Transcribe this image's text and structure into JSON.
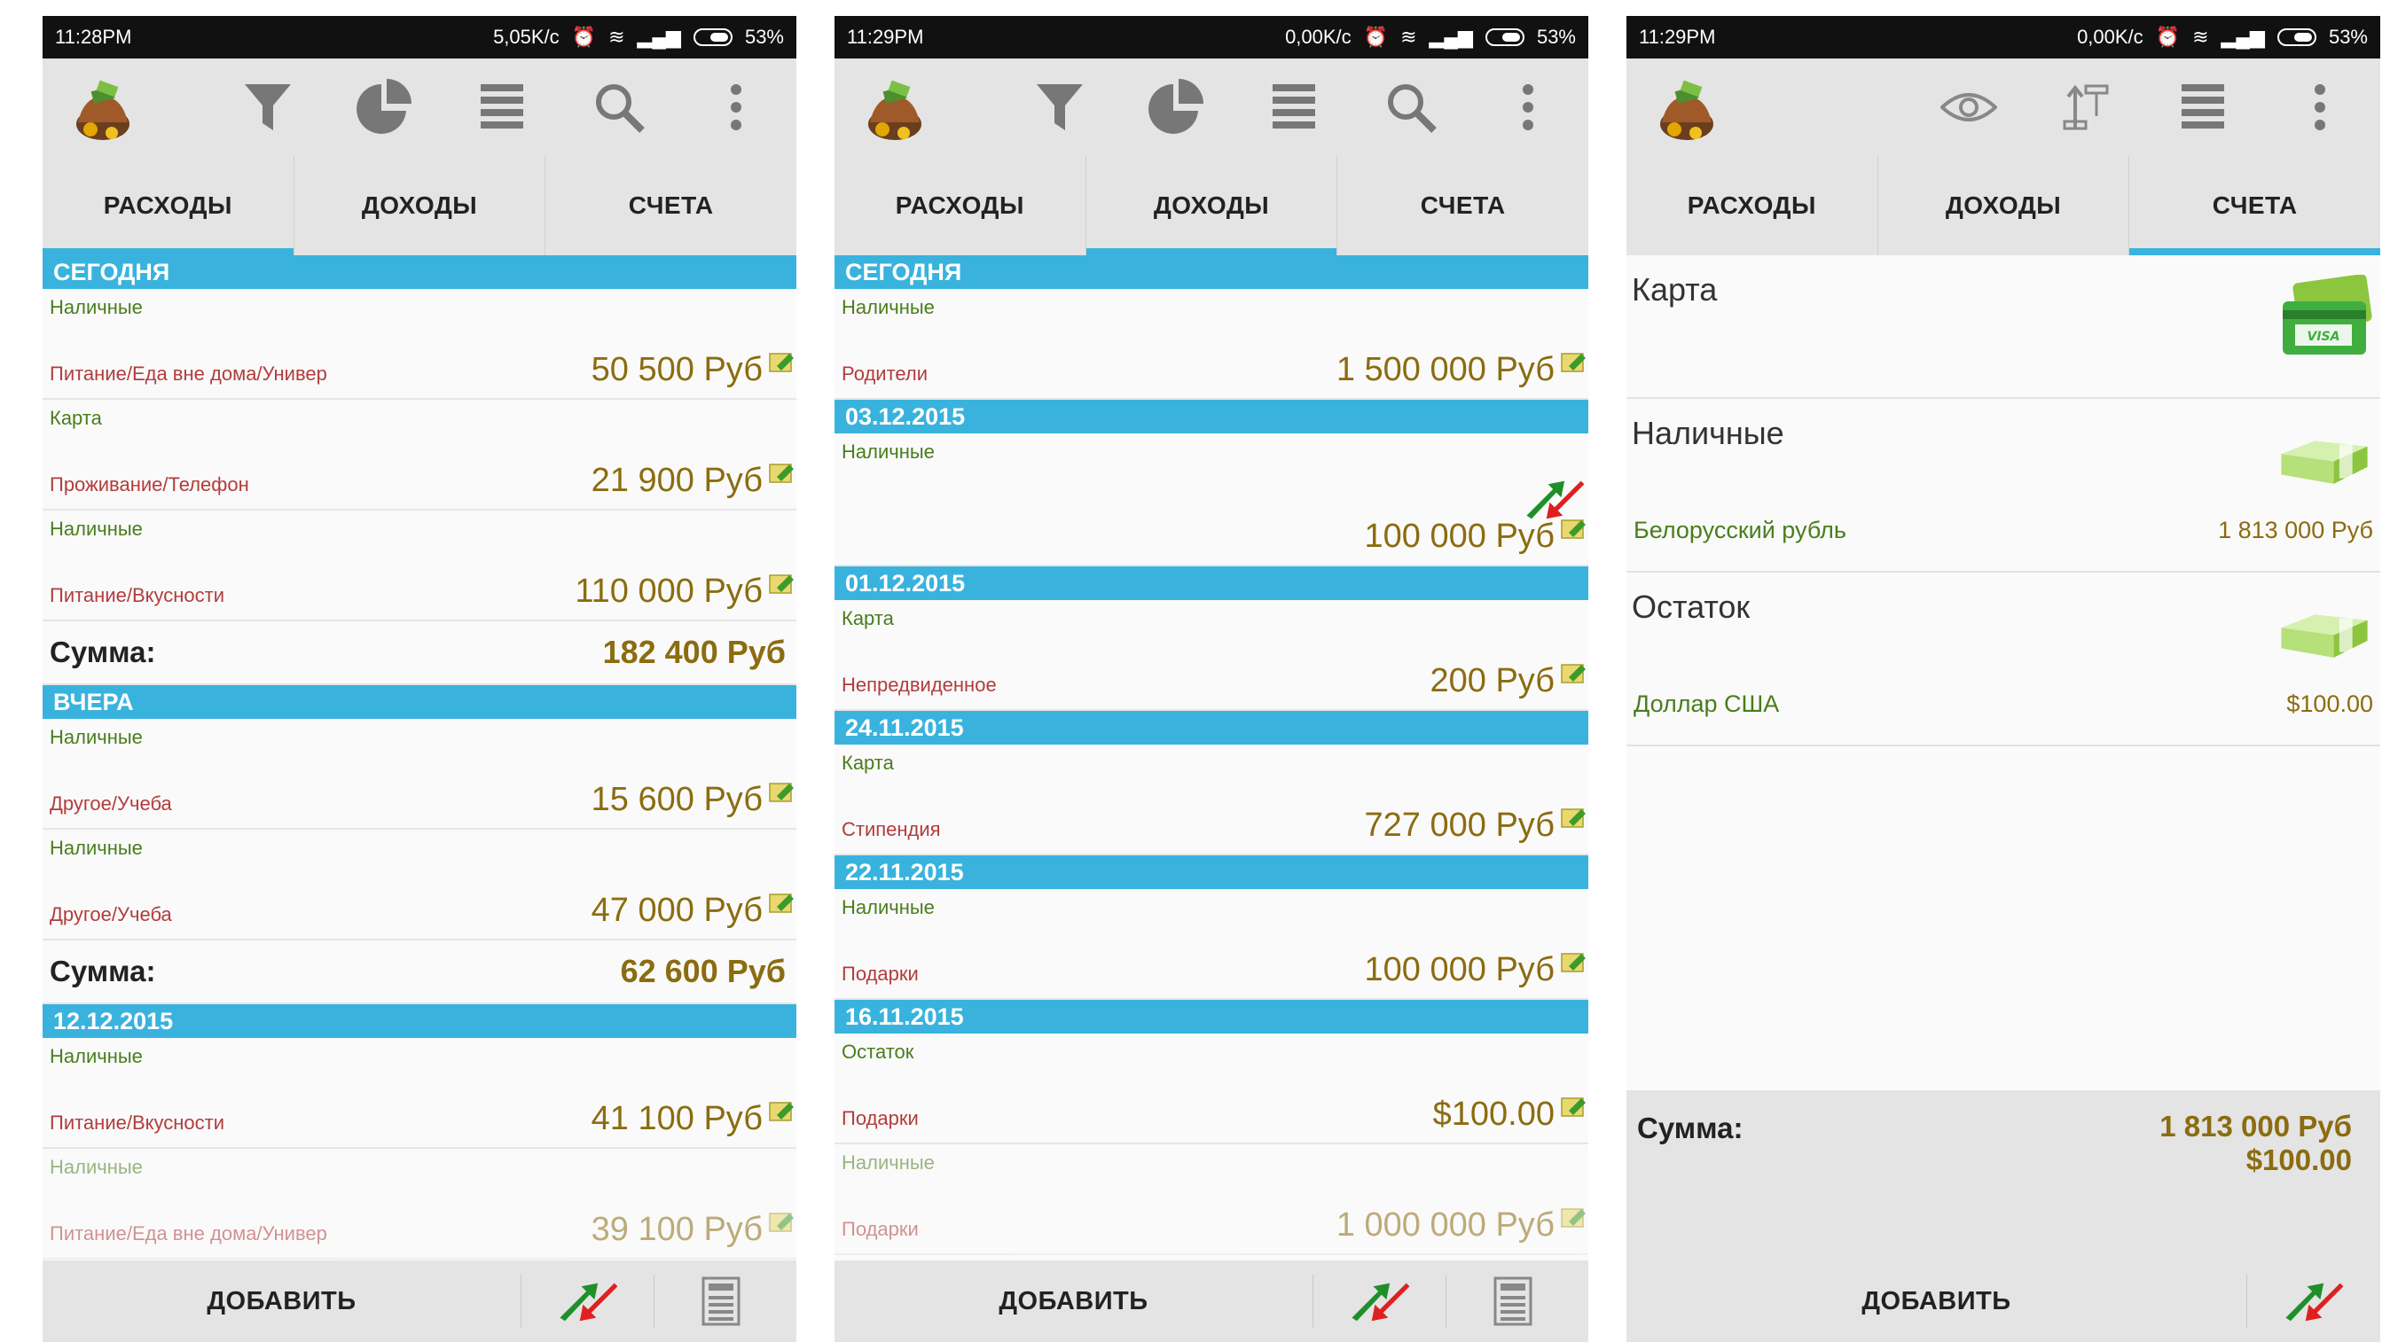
{
  "currency_suffix": "Руб",
  "colors": {
    "header": "#39b3dd",
    "amount": "#8b6c10",
    "account": "#4a7d1d",
    "category": "#b23c3c"
  },
  "tabs": [
    "РАСХОДЫ",
    "ДОХОДЫ",
    "СЧЕТА"
  ],
  "add_label": "ДОБАВИТЬ",
  "sum_label": "Сумма:",
  "expenses": {
    "status": {
      "time": "11:28PM",
      "speed": "5,05K/c",
      "battery": "53%"
    },
    "groups": [
      {
        "header": "СЕГОДНЯ",
        "entries": [
          {
            "account": "Наличные",
            "category": "Питание/Еда вне дома/Универ",
            "amount": "50 500 Руб"
          },
          {
            "account": "Карта",
            "category": "Проживание/Телефон",
            "amount": "21 900 Руб"
          },
          {
            "account": "Наличные",
            "category": "Питание/Вкусности",
            "amount": "110 000 Руб"
          }
        ],
        "sum": "182 400 Руб"
      },
      {
        "header": "ВЧЕРА",
        "entries": [
          {
            "account": "Наличные",
            "category": "Другое/Учеба",
            "amount": "15 600 Руб"
          },
          {
            "account": "Наличные",
            "category": "Другое/Учеба",
            "amount": "47 000 Руб"
          }
        ],
        "sum": "62 600 Руб"
      },
      {
        "header": "12.12.2015",
        "entries": [
          {
            "account": "Наличные",
            "category": "Питание/Вкусности",
            "amount": "41 100 Руб"
          },
          {
            "account": "Наличные",
            "category": "Питание/Еда вне дома/Универ",
            "amount": "39 100 Руб"
          }
        ]
      }
    ]
  },
  "income": {
    "status": {
      "time": "11:29PM",
      "speed": "0,00K/c",
      "battery": "53%"
    },
    "groups": [
      {
        "header": "СЕГОДНЯ",
        "entries": [
          {
            "account": "Наличные",
            "category": "Родители",
            "amount": "1 500 000 Руб"
          }
        ]
      },
      {
        "header": "03.12.2015",
        "entries": [
          {
            "account": "Наличные",
            "category": "",
            "amount": "100 000 Руб",
            "transfer": true
          }
        ]
      },
      {
        "header": "01.12.2015",
        "entries": [
          {
            "account": "Карта",
            "category": "Непредвиденное",
            "amount": "200 Руб"
          }
        ]
      },
      {
        "header": "24.11.2015",
        "entries": [
          {
            "account": "Карта",
            "category": "Стипендия",
            "amount": "727 000 Руб"
          }
        ]
      },
      {
        "header": "22.11.2015",
        "entries": [
          {
            "account": "Наличные",
            "category": "Подарки",
            "amount": "100 000 Руб"
          }
        ]
      },
      {
        "header": "16.11.2015",
        "entries": [
          {
            "account": "Остаток",
            "category": "Подарки",
            "amount": "$100.00"
          },
          {
            "account": "Наличные",
            "category": "Подарки",
            "amount": "1 000 000 Руб"
          }
        ]
      }
    ]
  },
  "accounts": {
    "status": {
      "time": "11:29PM",
      "speed": "0,00K/c",
      "battery": "53%"
    },
    "items": [
      {
        "name": "Карта",
        "currency": "",
        "balance": "",
        "icon": "visa-card-icon"
      },
      {
        "name": "Наличные",
        "currency": "Белорусский рубль",
        "balance": "1 813 000 Руб",
        "icon": "cash-icon"
      },
      {
        "name": "Остаток",
        "currency": "Доллар США",
        "balance": "$100.00",
        "icon": "cash-icon"
      }
    ],
    "total_label": "Сумма:",
    "total_values": [
      "1 813 000 Руб",
      "$100.00"
    ],
    "visa_text": "VISA"
  }
}
